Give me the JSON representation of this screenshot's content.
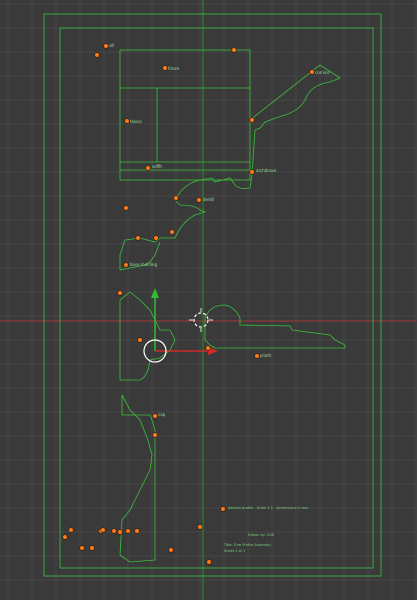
{
  "viewport": {
    "background": "#3a3a3a",
    "grid_color": "#474747",
    "outline_color": "#3cc13c",
    "point_color": "#ff7a1a",
    "axis_x_color": "#b33b3b",
    "axis_y_color": "#2d8a2d"
  },
  "labels": {
    "top": "sill",
    "mid_top": "frieze",
    "right_top": "cornice",
    "left_mid": "fascia",
    "right_mid": "architrave",
    "center_mid": "soffit",
    "center_low": "dentil",
    "base": "base molding",
    "right_low": "plinth",
    "center_lower": "cap",
    "bottom_note1": "Section profile - Scale 1:5 - dimensions in mm",
    "bottom_note2": "Drawn by: CAD",
    "bottom_note3": "Title: Trim Profile Assembly",
    "bottom_note4": "Sheet 1 of 1"
  }
}
